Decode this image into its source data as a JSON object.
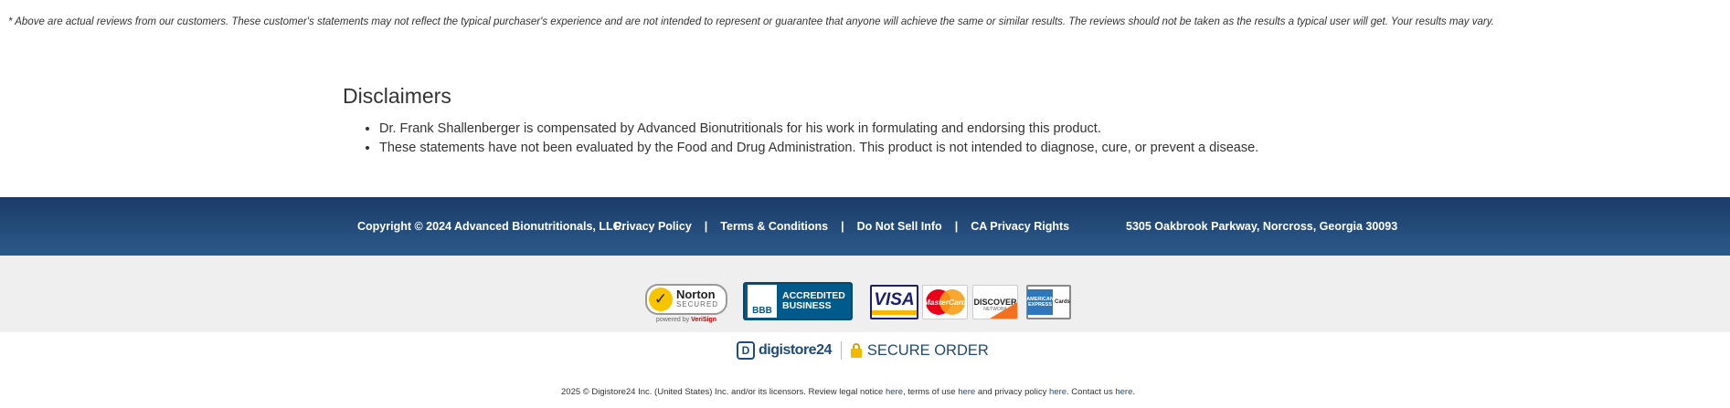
{
  "reviews_note": "* Above are actual reviews from our customers. These customer's statements may not reflect the typical purchaser's experience and are not intended to represent or guarantee that anyone will achieve the same or similar results. The reviews should not be taken as the results a typical user will get. Your results may vary.",
  "disclaimers": {
    "title": "Disclaimers",
    "items": [
      "Dr. Frank Shallenberger is compensated by Advanced Bionutritionals for his work in formulating and endorsing this product.",
      "These statements have not been evaluated by the Food and Drug Administration. This product is not intended to diagnose, cure, or prevent a disease."
    ]
  },
  "footer": {
    "copyright": "Copyright © 2024 Advanced Bionutritionals, LLC.",
    "links": [
      "Privacy Policy",
      "Terms & Conditions",
      "Do Not Sell Info",
      "CA Privacy Rights"
    ],
    "separator": "|",
    "address": "5305 Oakbrook Parkway, Norcross, Georgia 30093",
    "colors": {
      "bar_top": "#1c3b68",
      "bar_bottom": "#2b5a8a"
    }
  },
  "badges": {
    "norton": {
      "name": "Norton",
      "sub": "SECURED",
      "powered_prefix": "powered by ",
      "powered_brand": "VeriSign"
    },
    "bbb": {
      "logo": "BBB",
      "line1": "ACCREDITED",
      "line2": "BUSINESS"
    },
    "cards": {
      "visa": "VISA",
      "mastercard": "MasterCard",
      "discover": "DISCOVER",
      "discover_sub": "NETWORK",
      "amex": "AMERICAN EXPRESS",
      "amex_sub": "Cards"
    }
  },
  "secure": {
    "brand": "digistore24",
    "label": "SECURE ORDER"
  },
  "legal": {
    "text1": "2025 © Digistore24 Inc. (United States) Inc. and/or its licensors. Review legal notice ",
    "link1": "here",
    "text2": ", terms of use ",
    "link2": "here",
    "text3": " and privacy policy ",
    "link3": "here",
    "text4": ". Contact us ",
    "link4": "here",
    "text5": "."
  }
}
